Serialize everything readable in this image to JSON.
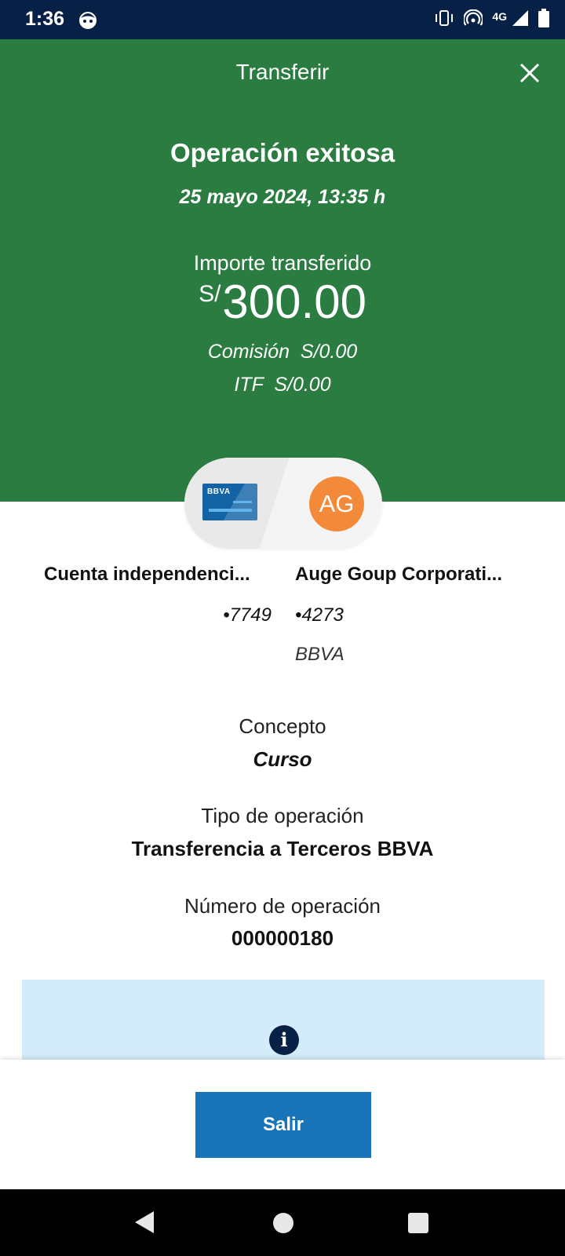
{
  "status_bar": {
    "time": "1:36",
    "network": "4G",
    "icons": [
      "face-icon",
      "vibrate-icon",
      "hotspot-icon",
      "signal-icon",
      "battery-icon"
    ]
  },
  "header": {
    "title": "Transferir",
    "status": "Operación exitosa",
    "datetime": "25 mayo 2024, 13:35 h",
    "amount_label": "Importe transferido",
    "currency": "S/",
    "amount": "300.00",
    "commission": "Comisión  S/0.00",
    "itf": "ITF  S/0.00",
    "background_color": "#2b7c40"
  },
  "transfer": {
    "from": {
      "card_logo": "BBVA",
      "name": "Cuenta independenci...",
      "account": "•7749"
    },
    "to": {
      "initials": "AG",
      "name": "Auge Goup Corporati...",
      "account": "•4273",
      "bank": "BBVA",
      "avatar_color": "#f28a3a"
    }
  },
  "details": {
    "concept_label": "Concepto",
    "concept_value": "Curso",
    "type_label": "Tipo de operación",
    "type_value": "Transferencia a Terceros BBVA",
    "number_label": "Número de operación",
    "number_value": "000000180"
  },
  "info": {
    "icon": "info-icon"
  },
  "footer": {
    "exit_label": "Salir",
    "button_color": "#1973b8"
  }
}
